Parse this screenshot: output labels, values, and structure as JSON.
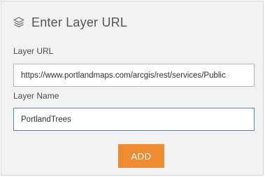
{
  "dialog": {
    "title": "Enter Layer URL",
    "title_icon": "layers-icon"
  },
  "form": {
    "layer_url": {
      "label": "Layer URL",
      "value": "https://www.portlandmaps.com/arcgis/rest/services/Public"
    },
    "layer_name": {
      "label": "Layer Name",
      "value": "PortlandTrees"
    },
    "add_label": "ADD"
  },
  "colors": {
    "accent": "#ee8b33",
    "focus_border": "#5d84b8",
    "panel_background": "#f2f2f2"
  }
}
